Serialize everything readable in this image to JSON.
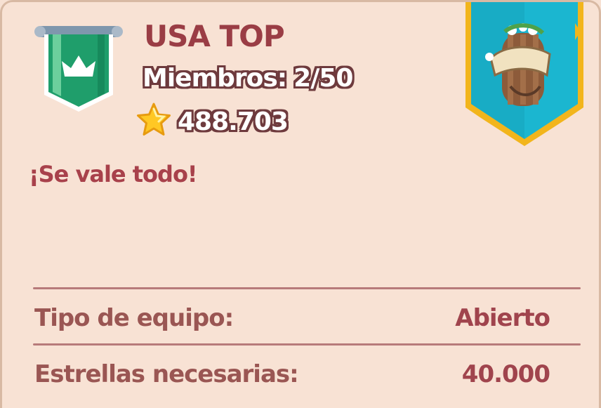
{
  "team": {
    "name": "USA TOP",
    "members_label": "Miembros:",
    "members_value": "2/50",
    "stars_value": "488.703",
    "motto": "¡Se vale todo!"
  },
  "details": {
    "type_label": "Tipo de equipo:",
    "type_value": "Abierto",
    "required_stars_label": "Estrellas necesarias:",
    "required_stars_value": "40.000"
  },
  "icons": {
    "banner": "crown-banner-icon",
    "star": "star-icon",
    "emblem": "horn-shield-emblem-icon"
  },
  "colors": {
    "panel_bg": "#f8e2d4",
    "title": "#9a3d45",
    "banner_green": "#1f9e6b",
    "emblem_blue": "#1bb6d0",
    "emblem_gold": "#f2b51c"
  }
}
